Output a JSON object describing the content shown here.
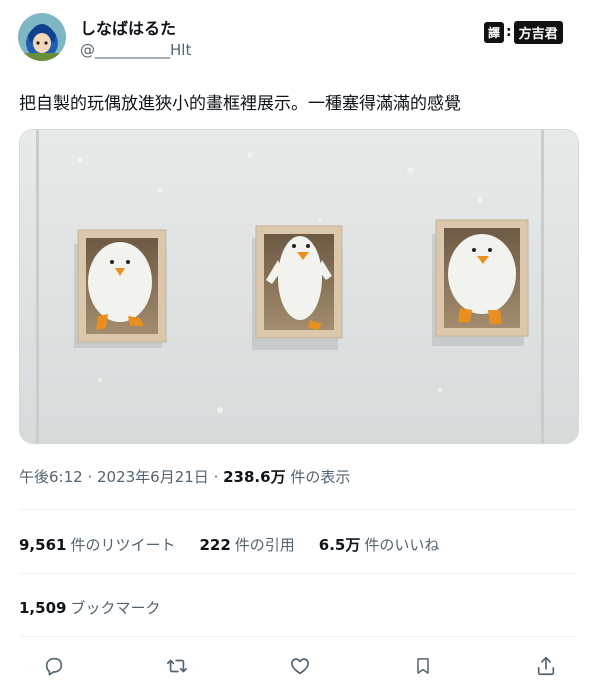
{
  "author": {
    "display_name": "しなばはるた",
    "handle": "@__________Hlt"
  },
  "translator_badge": {
    "label": "譯",
    "separator": ":",
    "name": "方吉君"
  },
  "tweet": {
    "text": "把自製的玩偶放進狹小的畫框裡展示。一種塞得滿滿的感覺",
    "photo_description": "Three white penguin-like plush toys inside small wooden shadow-box frames on a white wall"
  },
  "meta": {
    "time": "午後6:12",
    "sep1": " · ",
    "date": "2023年6月21日",
    "sep2": " · ",
    "views": "238.6万",
    "views_label": " 件の表示"
  },
  "stats": {
    "retweets": "9,561",
    "retweets_label": "件のリツイート",
    "quotes": "222",
    "quotes_label": "件の引用",
    "likes": "6.5万",
    "likes_label": "件のいいね",
    "bookmarks": "1,509",
    "bookmarks_label": "ブックマーク"
  },
  "actions": [
    "reply-icon",
    "retweet-icon",
    "like-icon",
    "bookmark-icon",
    "share-icon"
  ],
  "colors": {
    "text_primary": "#0f1419",
    "text_secondary": "#536471",
    "divider": "#eff3f4",
    "wall": "#e6e8e8",
    "frame_wood": "#d9c6ab"
  }
}
